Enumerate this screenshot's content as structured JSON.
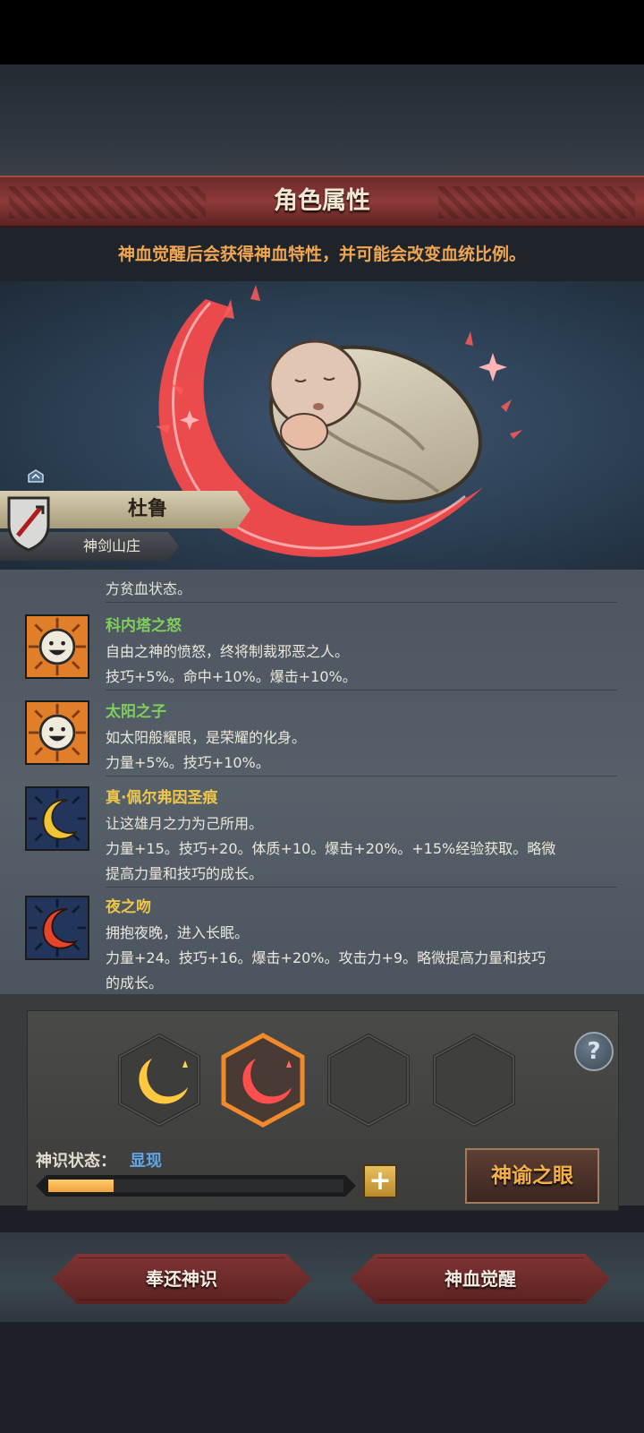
{
  "header": {
    "title": "角色属性"
  },
  "subtitle": "神血觉醒后会获得神血特性，并可能会改变血统比例。",
  "character": {
    "name": "杜鲁",
    "clan": "神剑山庄"
  },
  "traits": {
    "cut_top_text": "方贫血状态。",
    "items": [
      {
        "name": "科内塔之怒",
        "name_color": "#7fcf5a",
        "icon": "sun-face-icon",
        "lines": [
          "自由之神的愤怒，终将制裁邪恶之人。",
          "技巧+5%。命中+10%。爆击+10%。"
        ]
      },
      {
        "name": "太阳之子",
        "name_color": "#7fcf5a",
        "icon": "sun-face-icon",
        "lines": [
          "如太阳般耀眼，是荣耀的化身。",
          "力量+5%。技巧+10%。"
        ]
      },
      {
        "name": "真·佩尔弗因圣痕",
        "name_color": "#f0c64a",
        "icon": "gold-crescent-icon",
        "lines": [
          "让这雄月之力为己所用。",
          "力量+15。技巧+20。体质+10。爆击+20%。+15%经验获取。略微",
          "提高力量和技巧的成长。"
        ]
      },
      {
        "name": "夜之吻",
        "name_color": "#f0c64a",
        "icon": "red-crescent-icon",
        "lines": [
          "拥抱夜晚，进入长眠。",
          "力量+24。技巧+16。爆击+20%。攻击力+9。略微提高力量和技巧",
          "的成长。"
        ]
      }
    ]
  },
  "ability": {
    "slots": [
      "gold-crescent-icon",
      "red-crescent-icon",
      "empty",
      "empty"
    ],
    "help_label": "?",
    "state_label": "神识状态：",
    "state_value": "显现",
    "progress": 0.22,
    "plus_label": "+",
    "oracle_button": "神谕之眼"
  },
  "buttons": {
    "return": "奉还神识",
    "awaken": "神血觉醒"
  }
}
